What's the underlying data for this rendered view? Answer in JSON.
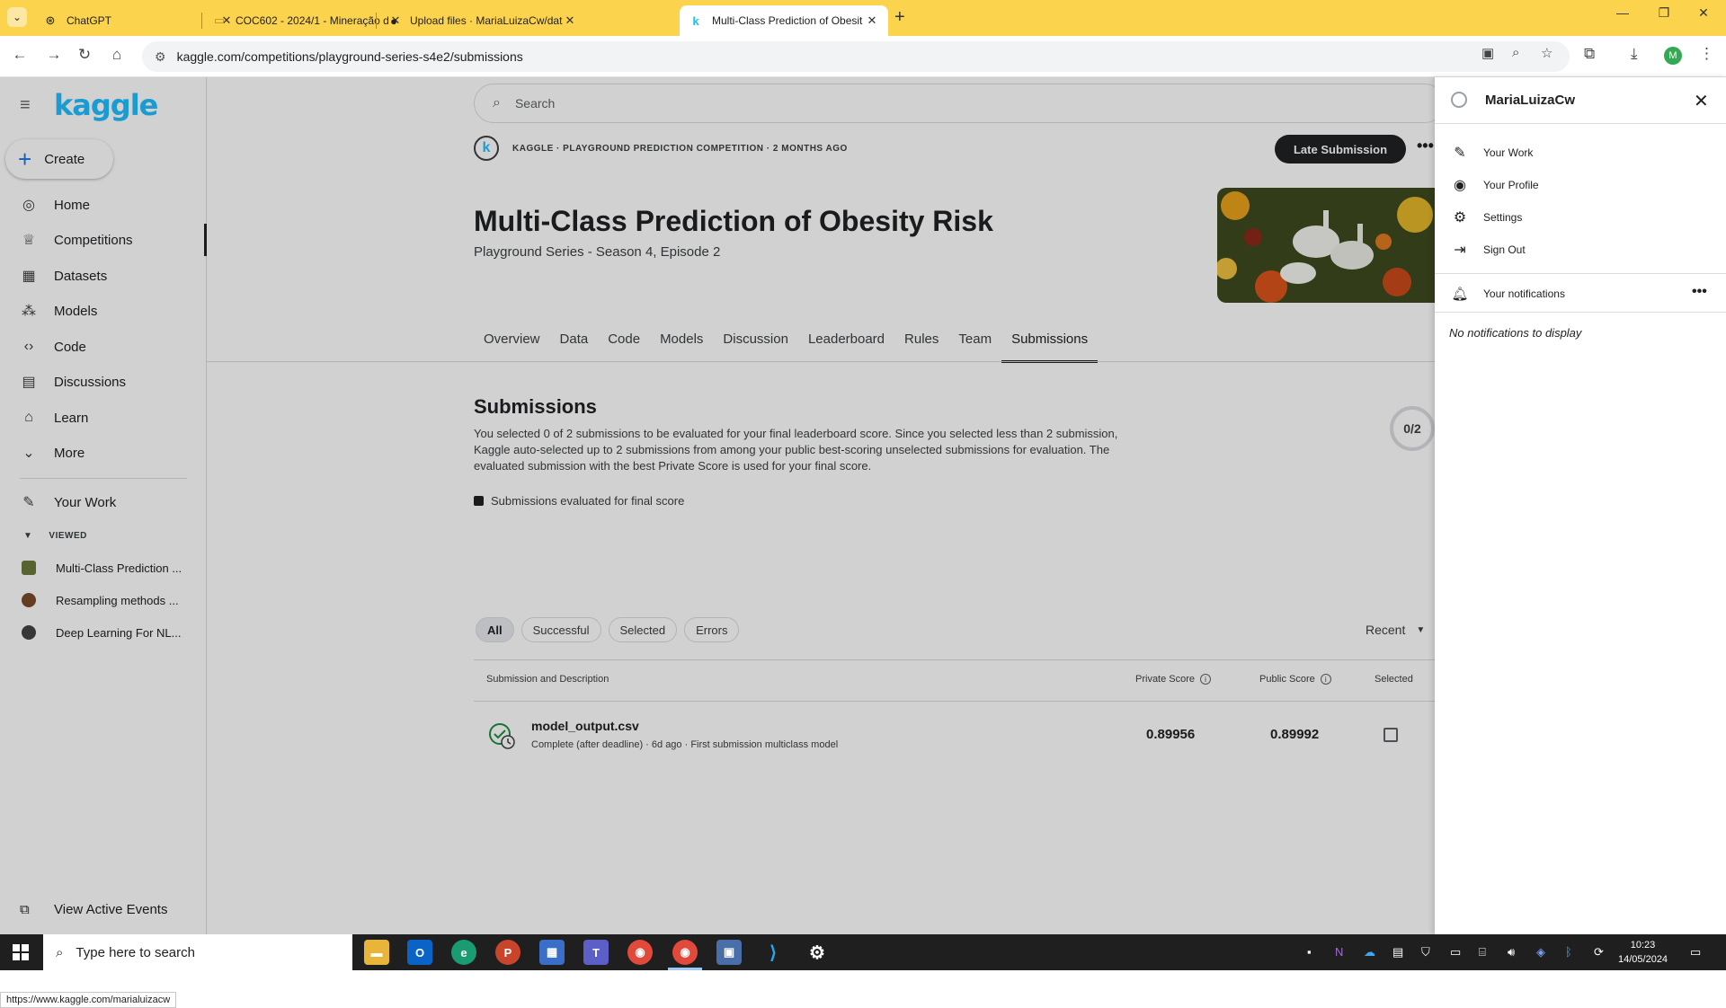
{
  "browser": {
    "tabs": [
      {
        "title": "ChatGPT",
        "icon": "chatgpt-icon"
      },
      {
        "title": "COC602 - 2024/1 - Mineração d",
        "icon": "folder-icon"
      },
      {
        "title": "Upload files · MariaLuizaCw/dat",
        "icon": "github-icon"
      },
      {
        "title": "Multi-Class Prediction of Obesit",
        "icon": "kaggle-icon"
      }
    ],
    "url": "kaggle.com/competitions/playground-series-s4e2/submissions",
    "profile_initial": "M"
  },
  "kaggle": {
    "logo": "kaggle",
    "create_label": "Create",
    "nav": [
      {
        "label": "Home",
        "icon": "compass-icon"
      },
      {
        "label": "Competitions",
        "icon": "trophy-icon"
      },
      {
        "label": "Datasets",
        "icon": "table-icon"
      },
      {
        "label": "Models",
        "icon": "models-icon"
      },
      {
        "label": "Code",
        "icon": "code-icon"
      },
      {
        "label": "Discussions",
        "icon": "comment-icon"
      },
      {
        "label": "Learn",
        "icon": "school-icon"
      },
      {
        "label": "More",
        "icon": "chevron-down-icon"
      }
    ],
    "your_work": "Your Work",
    "viewed_label": "VIEWED",
    "viewed": [
      {
        "label": "Multi-Class Prediction ..."
      },
      {
        "label": "Resampling methods ..."
      },
      {
        "label": "Deep Learning For NL..."
      }
    ],
    "view_active_events": "View Active Events",
    "status_url": "https://www.kaggle.com/marialuizacw"
  },
  "main": {
    "search_placeholder": "Search",
    "comp_meta": "KAGGLE · PLAYGROUND PREDICTION COMPETITION · 2 MONTHS AGO",
    "late_submission": "Late Submission",
    "title": "Multi-Class Prediction of Obesity Risk",
    "subtitle": "Playground Series - Season 4, Episode 2",
    "tabs": [
      "Overview",
      "Data",
      "Code",
      "Models",
      "Discussion",
      "Leaderboard",
      "Rules",
      "Team",
      "Submissions"
    ],
    "submissions_title": "Submissions",
    "submissions_desc": "You selected 0 of 2 submissions to be evaluated for your final leaderboard score. Since you selected less than 2 submission, Kaggle auto-selected up to 2 submissions from among your public best-scoring unselected submissions for evaluation. The evaluated submission with the best Private Score is used for your final score.",
    "selected_count": "0/2",
    "legend": "Submissions evaluated for final score",
    "filters": [
      "All",
      "Successful",
      "Selected",
      "Errors"
    ],
    "sort": "Recent",
    "columns": {
      "desc": "Submission and Description",
      "private": "Private Score",
      "public": "Public Score",
      "selected": "Selected"
    },
    "rows": [
      {
        "name": "model_output.csv",
        "meta": "Complete (after deadline) · 6d ago · First submission multiclass model",
        "private": "0.89956",
        "public": "0.89992"
      }
    ]
  },
  "panel": {
    "username": "MariaLuizaCw",
    "items": [
      {
        "label": "Your Work",
        "icon": "edit-box-icon"
      },
      {
        "label": "Your Profile",
        "icon": "user-circle-icon"
      },
      {
        "label": "Settings",
        "icon": "gear-icon"
      },
      {
        "label": "Sign Out",
        "icon": "sign-out-icon"
      }
    ],
    "notifications_label": "Your notifications",
    "empty": "No notifications to display"
  },
  "taskbar": {
    "search": "Type here to search",
    "time": "10:23",
    "date": "14/05/2024"
  }
}
